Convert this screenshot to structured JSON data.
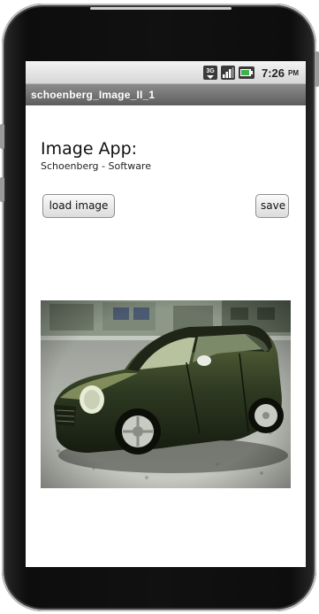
{
  "status_bar": {
    "network_label": "3G",
    "time": "7:26",
    "ampm": "PM",
    "icons": [
      "network-3g-icon",
      "signal-strength-icon",
      "battery-icon"
    ]
  },
  "app_bar": {
    "title": "schoenberg_Image_II_1"
  },
  "main": {
    "heading": "Image App:",
    "subheading": "Schoenberg - Software",
    "load_button_label": "load image",
    "save_button_label": "save",
    "image_subject": "dark green mini car photo"
  },
  "colors": {
    "title_bar": "#707070",
    "status_bar": "#e4e4e4",
    "button_face": "#e8e8e8",
    "car_body": "#2c3a22"
  }
}
